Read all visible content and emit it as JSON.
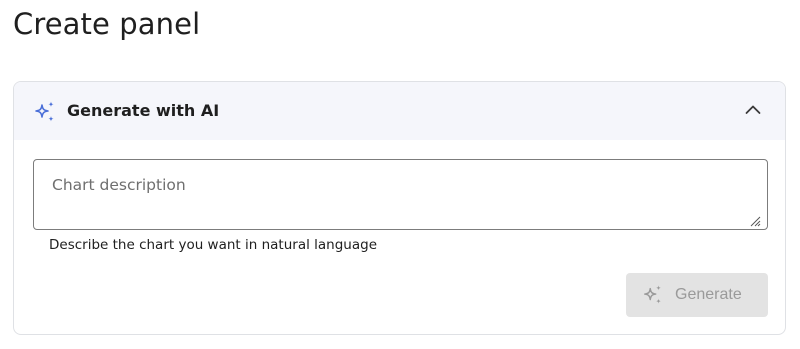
{
  "page": {
    "title": "Create panel"
  },
  "ai_panel": {
    "header_label": "Generate with AI",
    "expanded": true,
    "description_field": {
      "placeholder": "Chart description",
      "value": ""
    },
    "helper_text": "Describe the chart you want in natural language",
    "generate_button": {
      "label": "Generate",
      "disabled": true
    }
  },
  "icons": {
    "header_icon": "sparkle-icon",
    "toggle_icon": "chevron-up-icon",
    "button_icon": "sparkle-icon"
  },
  "colors": {
    "accent": "#4a6fd8",
    "header_bg": "#f5f6fb",
    "disabled_bg": "#e3e3e3",
    "disabled_text": "#9a9a9a"
  }
}
